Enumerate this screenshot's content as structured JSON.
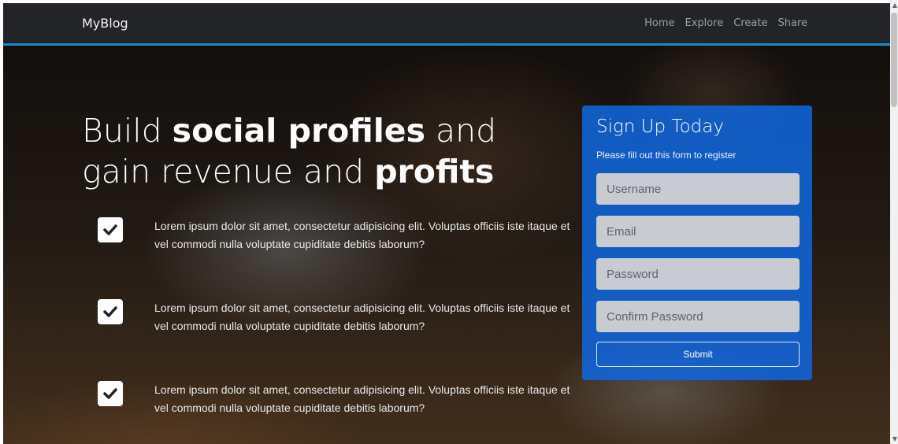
{
  "navbar": {
    "brand": "MyBlog",
    "links": [
      "Home",
      "Explore",
      "Create",
      "Share"
    ]
  },
  "hero": {
    "headline_parts": [
      "Build ",
      "social profiles",
      " and gain revenue and ",
      "profits"
    ],
    "features": [
      {
        "icon": "check-icon",
        "text": "Lorem ipsum dolor sit amet, consectetur adipisicing elit. Voluptas officiis iste itaque et vel commodi nulla voluptate cupiditate debitis laborum?"
      },
      {
        "icon": "check-icon",
        "text": "Lorem ipsum dolor sit amet, consectetur adipisicing elit. Voluptas officiis iste itaque et vel commodi nulla voluptate cupiditate debitis laborum?"
      },
      {
        "icon": "check-icon",
        "text": "Lorem ipsum dolor sit amet, consectetur adipisicing elit. Voluptas officiis iste itaque et vel commodi nulla voluptate cupiditate debitis laborum?"
      }
    ]
  },
  "signup": {
    "title": "Sign Up Today",
    "subtitle": "Please fill out this form to register",
    "fields": {
      "username": "Username",
      "email": "Email",
      "password": "Password",
      "confirm_password": "Confirm Password"
    },
    "submit_label": "Submit"
  },
  "colors": {
    "navbar_bg": "#222427",
    "navbar_accent": "#1f86c8",
    "form_bg": "#1066de"
  }
}
